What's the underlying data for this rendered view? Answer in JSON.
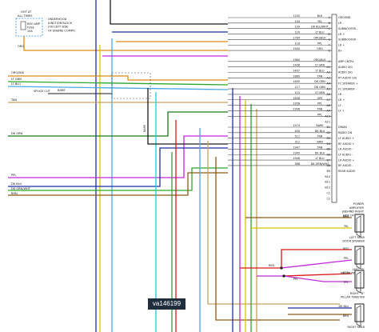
{
  "fuse_box": {
    "hot": "HOT AT",
    "all_times": "ALL TIMES",
    "fuse_rating": "RDO AMP",
    "fuse_word": "FUSE",
    "amps": "15A",
    "desc": [
      "UNDERHOOD",
      "JUNCTION BLOCK",
      "(ON LEFT SIDE",
      "OF ENGINE COMPT)"
    ]
  },
  "left_labels": {
    "org": "ORG",
    "orgblk": "ORG/BLK",
    "ltgrn": "LT GRN",
    "ltblu": "LT BLU",
    "splice": "SPLICE CUT",
    "bare1": "BARE",
    "tan": "TAN",
    "dkgrn": "DK GRN",
    "ppl": "PPL",
    "dkblu": "DK BLU",
    "dkgrnwht": "DK GRN/WHT",
    "brn": "BRN",
    "bare2": "BARE"
  },
  "connector_rows": [
    {
      "circ": "1250",
      "color": "BLK",
      "pin": "A",
      "label": "GROUND"
    },
    {
      "circ": "104",
      "color": "YEL",
      "pin": "B",
      "label": "LR -"
    },
    {
      "circ": "199",
      "color": "DK BLU/WHT",
      "pin": "C",
      "label": "SUBWOOFER -"
    },
    {
      "circ": "116",
      "color": "LT BLU",
      "pin": "D",
      "label": "LR +"
    },
    {
      "circ": "1784",
      "color": "ORG/BLK",
      "pin": "E",
      "label": "SUBWOOFER -"
    },
    {
      "circ": "118",
      "color": "PPL",
      "pin": "F",
      "label": "LR +"
    },
    {
      "circ": "1940",
      "color": "ORG",
      "pin": "G",
      "label": "B+"
    },
    {
      "circ": "",
      "color": "",
      "pin": "",
      "label": ""
    },
    {
      "circ": "1960",
      "color": "ORG/BLK",
      "pin": "H",
      "label": "AMP CNTRL"
    },
    {
      "circ": "1408",
      "color": "LT GRN",
      "pin": "A1",
      "label": "AUDIO SIG"
    },
    {
      "circ": "1407",
      "color": "LT BLU",
      "pin": "A2",
      "label": "AUDIO SIG"
    },
    {
      "circ": "1860",
      "color": "TAN",
      "pin": "A3",
      "label": "RT AUDIO SIG"
    },
    {
      "circ": "1800",
      "color": "DK GRN",
      "pin": "A4",
      "label": "FC SPEAKER +"
    },
    {
      "circ": "117",
      "color": "DK GRN",
      "pin": "A5",
      "label": "FC SPEAKER -"
    },
    {
      "circ": "115",
      "color": "LT GRN",
      "pin": "A6",
      "label": "LR -"
    },
    {
      "circ": "1838",
      "color": "GRY",
      "pin": "A7",
      "label": "LR +"
    },
    {
      "circ": "1958",
      "color": "PPL",
      "pin": "A8",
      "label": "LF -"
    },
    {
      "circ": "1996",
      "color": "TAN",
      "pin": "A9",
      "label": "LF +"
    },
    {
      "circ": "",
      "color": "PPL",
      "pin": "A10",
      "label": ""
    },
    {
      "circ": "",
      "color": "",
      "pin": "A11",
      "label": ""
    },
    {
      "circ": "1574",
      "color": "BARE",
      "pin": "B1",
      "label": "DRAIN"
    },
    {
      "circ": "400",
      "color": "DK BLU",
      "pin": "B2",
      "label": "RADIO ON"
    },
    {
      "circ": "511",
      "color": "TAN",
      "pin": "B3",
      "label": "LF AUDIO +"
    },
    {
      "circ": "312",
      "color": "BRN",
      "pin": "B4",
      "label": "RF AUDIO +"
    },
    {
      "circ": "1947",
      "color": "TAN",
      "pin": "B5",
      "label": "LR AUDIO -"
    },
    {
      "circ": "1949",
      "color": "DK BLU",
      "pin": "B6",
      "label": "LF AUDIO -"
    },
    {
      "circ": "1948",
      "color": "LT BLU",
      "pin": "B7",
      "label": "LR AUDIO +"
    },
    {
      "circ": "368",
      "color": "DK GRN/WHT",
      "pin": "B8",
      "label": "RF AUDIO -"
    },
    {
      "circ": "",
      "color": "",
      "pin": "B9",
      "label": "REAR AUDIO"
    },
    {
      "circ": "",
      "color": "",
      "pin": "B10",
      "label": ""
    },
    {
      "circ": "",
      "color": "",
      "pin": "B11",
      "label": ""
    },
    {
      "circ": "",
      "color": "",
      "pin": "B12",
      "label": ""
    },
    {
      "circ": "",
      "color": "",
      "pin": "C1",
      "label": ""
    },
    {
      "circ": "",
      "color": "",
      "pin": "C2",
      "label": ""
    }
  ],
  "amp_label": [
    "POWER",
    "AMPLIFIER",
    "(BEHIND RIGHT",
    "SIDE OF DASH)"
  ],
  "speakers": [
    {
      "w1": "BRN",
      "w2": "YEL",
      "name": [
        "LEFT REAR",
        "DOOR SPEAKER"
      ]
    },
    {
      "w1": "RED",
      "w2": "PPL",
      "name": [
        "LEFT \"D\"",
        "PILLAR TWEETER"
      ]
    },
    {
      "w1": "RED",
      "w2": "PPL",
      "name": [
        "RIGHT \"D\"",
        "PILLAR TWEETER"
      ]
    },
    {
      "w1": "DK BLU",
      "w2": "BRN",
      "name": [
        "RIGHT REAR",
        ""
      ]
    }
  ],
  "mid_labels": {
    "red": "RED",
    "ppl": "PPL"
  },
  "bare_vertical": "BARE",
  "watermark": "va146199",
  "colors": {
    "black": "#1a1a1a",
    "gray": "#8a8a8a",
    "yellow": "#d8c800",
    "dk_blue": "#1c2fa8",
    "lt_blue": "#4aa8e8",
    "orange": "#e08a10",
    "purple": "#c02ad8",
    "green": "#2aa82a",
    "dk_green": "#1a7a1a",
    "tan": "#c8a060",
    "brown": "#8a5a1a",
    "red": "#d81818",
    "cyan": "#20c8d8"
  }
}
